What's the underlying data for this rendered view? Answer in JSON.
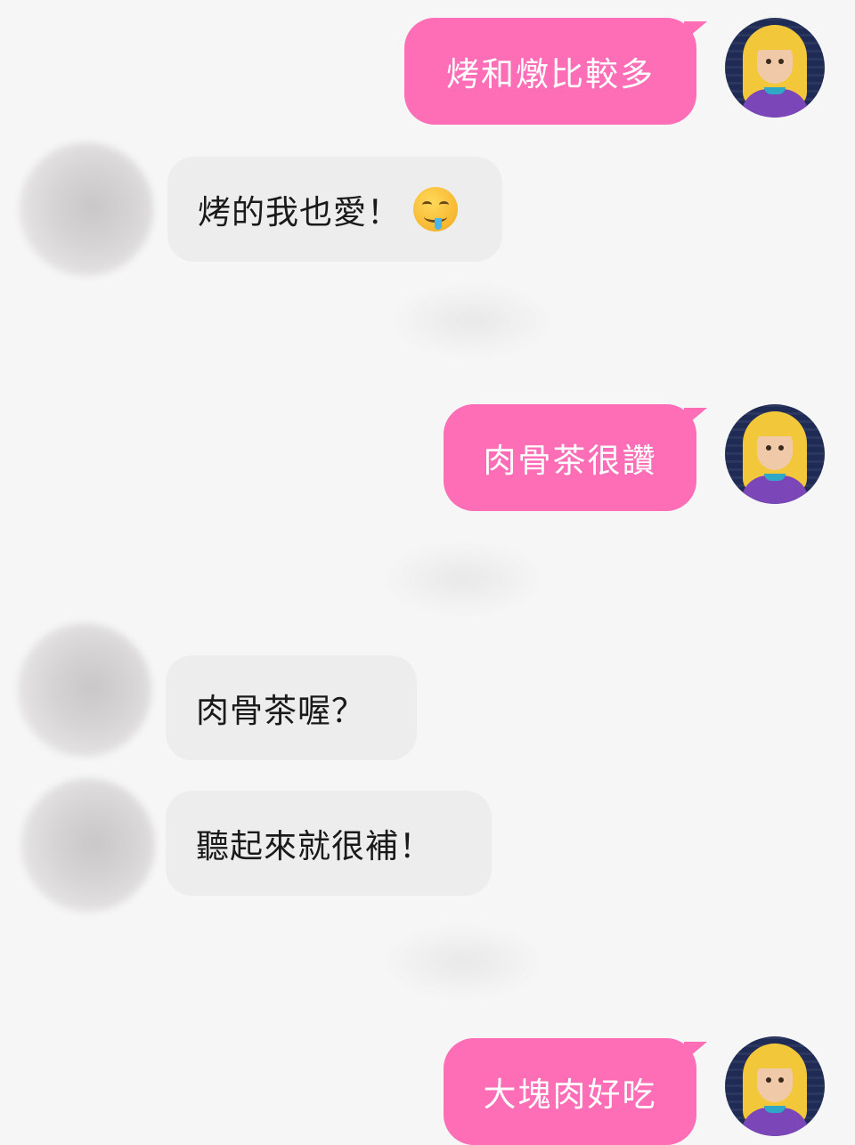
{
  "chat": {
    "messages": [
      {
        "sender": "me",
        "text": "烤和燉比較多"
      },
      {
        "sender": "other",
        "text": "烤的我也愛！",
        "emoji": "drooling-face-emoji"
      },
      {
        "sender": "me",
        "text": "肉骨茶很讚"
      },
      {
        "sender": "other",
        "text": "肉骨茶喔？"
      },
      {
        "sender": "other",
        "text": "聽起來就很補！"
      },
      {
        "sender": "me",
        "text": "大塊肉好吃"
      }
    ]
  },
  "colors": {
    "background": "#f6f6f6",
    "outgoing_bubble": "#fd6eb6",
    "incoming_bubble": "#ededed"
  }
}
